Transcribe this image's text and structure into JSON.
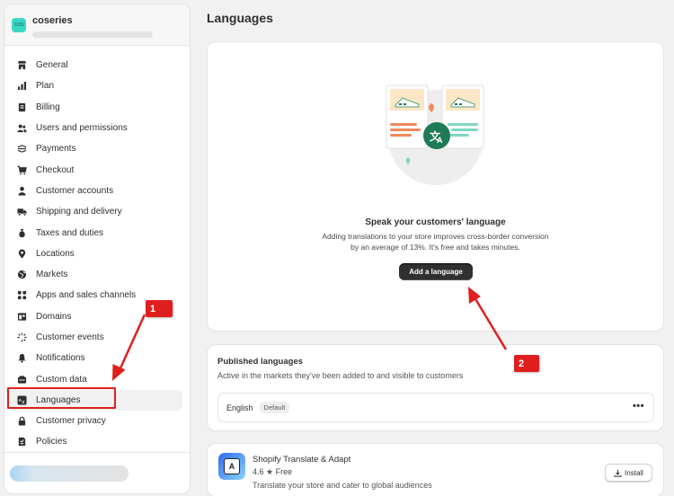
{
  "store": {
    "name": "coseries",
    "logo_text": "COS"
  },
  "sidebar": {
    "items": [
      {
        "label": "General",
        "icon": "store-icon"
      },
      {
        "label": "Plan",
        "icon": "plan-chart-icon"
      },
      {
        "label": "Billing",
        "icon": "billing-receipt-icon"
      },
      {
        "label": "Users and permissions",
        "icon": "users-icon"
      },
      {
        "label": "Payments",
        "icon": "payments-icon"
      },
      {
        "label": "Checkout",
        "icon": "cart-icon"
      },
      {
        "label": "Customer accounts",
        "icon": "person-icon"
      },
      {
        "label": "Shipping and delivery",
        "icon": "truck-icon"
      },
      {
        "label": "Taxes and duties",
        "icon": "tax-bag-icon"
      },
      {
        "label": "Locations",
        "icon": "location-pin-icon"
      },
      {
        "label": "Markets",
        "icon": "globe-icon"
      },
      {
        "label": "Apps and sales channels",
        "icon": "apps-grid-icon"
      },
      {
        "label": "Domains",
        "icon": "domains-icon"
      },
      {
        "label": "Customer events",
        "icon": "events-sparkle-icon"
      },
      {
        "label": "Notifications",
        "icon": "bell-icon"
      },
      {
        "label": "Custom data",
        "icon": "custom-data-icon"
      },
      {
        "label": "Languages",
        "icon": "language-icon"
      },
      {
        "label": "Customer privacy",
        "icon": "lock-icon"
      },
      {
        "label": "Policies",
        "icon": "policies-icon"
      }
    ],
    "active_index": 16
  },
  "main": {
    "title": "Languages",
    "hero": {
      "title": "Speak your customers' language",
      "desc_line1": "Adding translations to your store improves cross-border conversion",
      "desc_line2": "by an average of 13%. It's free and takes minutes.",
      "button": "Add a language"
    },
    "published": {
      "title": "Published languages",
      "desc": "Active in the markets they've been added to and visible to customers",
      "row": {
        "language": "English",
        "badge": "Default",
        "menu": "•••"
      }
    },
    "app": {
      "name": "Shopify Translate & Adapt",
      "rating": "4.6",
      "star": "★",
      "price": "Free",
      "desc": "Translate your store and cater to global audiences",
      "install": "Install"
    }
  },
  "annotations": {
    "marker1": "1",
    "marker2": "2",
    "color": "#e01e1e"
  }
}
